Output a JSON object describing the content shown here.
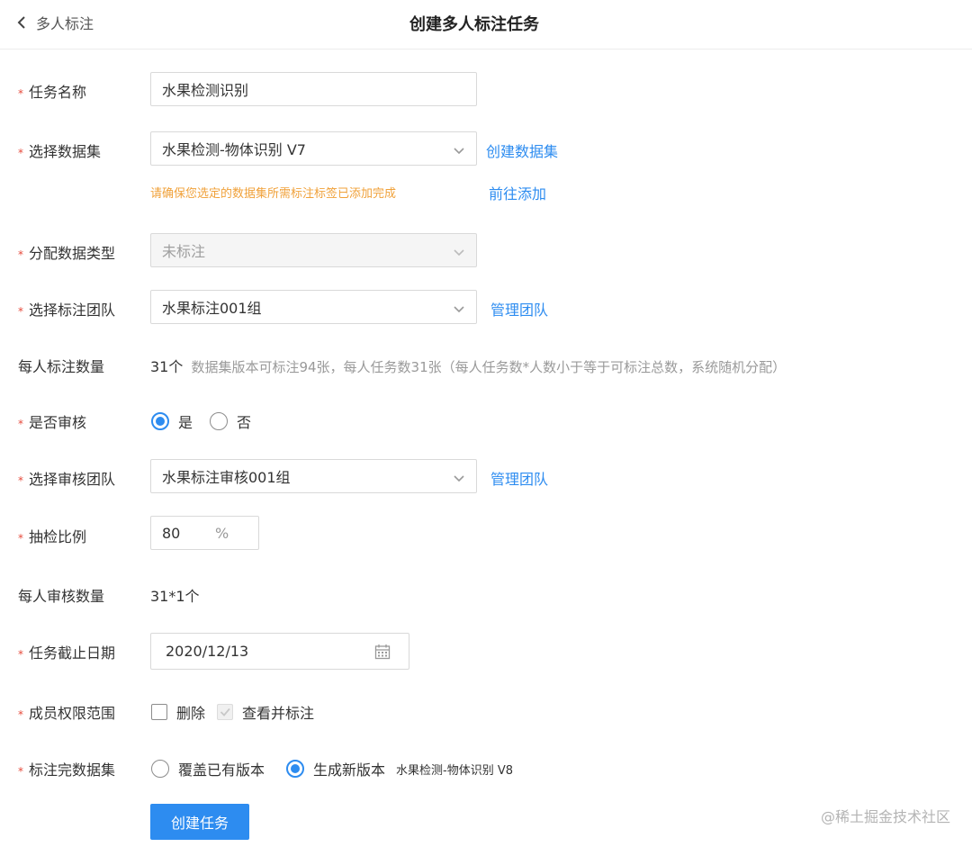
{
  "header": {
    "back_label": "多人标注",
    "title": "创建多人标注任务"
  },
  "form": {
    "task_name": {
      "label": "任务名称",
      "value": "水果检测识别"
    },
    "dataset": {
      "label": "选择数据集",
      "value": "水果检测-物体识别 V7",
      "create_link": "创建数据集",
      "hint": "请确保您选定的数据集所需标注标签已添加完成",
      "goto_link": "前往添加"
    },
    "data_type": {
      "label": "分配数据类型",
      "value": "未标注"
    },
    "label_team": {
      "label": "选择标注团队",
      "value": "水果标注001组",
      "manage_link": "管理团队"
    },
    "per_person": {
      "label": "每人标注数量",
      "count": "31个",
      "note": "数据集版本可标注94张，每人任务数31张（每人任务数*人数小于等于可标注总数，系统随机分配）"
    },
    "review": {
      "label": "是否审核",
      "options": [
        "是",
        "否"
      ],
      "selected": "是"
    },
    "review_team": {
      "label": "选择审核团队",
      "value": "水果标注审核001组",
      "manage_link": "管理团队"
    },
    "sampling": {
      "label": "抽检比例",
      "value": "80",
      "unit": "%"
    },
    "review_count": {
      "label": "每人审核数量",
      "value": "31*1个"
    },
    "deadline": {
      "label": "任务截止日期",
      "value": "2020/12/13"
    },
    "permissions": {
      "label": "成员权限范围",
      "options": [
        {
          "label": "删除",
          "checked": false
        },
        {
          "label": "查看并标注",
          "checked": true,
          "disabled": true
        }
      ]
    },
    "output": {
      "label": "标注完数据集",
      "options": [
        "覆盖已有版本",
        "生成新版本"
      ],
      "selected": "生成新版本",
      "new_version_name": "水果检测-物体识别 V8"
    },
    "submit_label": "创建任务"
  },
  "watermark": "@稀土掘金技术社区",
  "colors": {
    "primary": "#2d8cf0",
    "required": "#e64a3b",
    "hint": "#f0a13a"
  }
}
